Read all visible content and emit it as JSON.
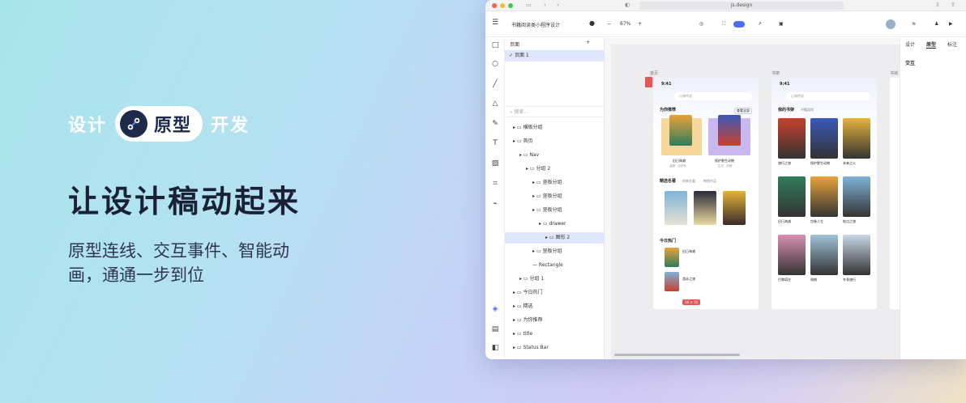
{
  "hero": {
    "tag_left": "设计",
    "pill_label": "原型",
    "tag_right": "开发",
    "headline": "让设计稿动起来",
    "subtitle": "原型连线、交互事件、智能动画，通通一步到位"
  },
  "browser": {
    "url": "js.design"
  },
  "toolbar": {
    "file_name": "书籍阅读类小程序设计",
    "zoom": "67%"
  },
  "layers": {
    "tab_label": "页面",
    "page": "页面 1",
    "search_placeholder": "搜索...",
    "items": [
      "横板分组",
      "首页",
      "Nav",
      "分组 2",
      "竖板分组",
      "竖板分组",
      "竖板分组",
      "drawer",
      "图形 2",
      "竖板分组",
      "Rectangle",
      "分组 1",
      "今日热门",
      "精选",
      "为你推荐",
      "title",
      "Status Bar"
    ]
  },
  "canvas": {
    "frame1_label": "首页",
    "frame2_label": "书架",
    "frame3_label": "书城",
    "size_tag": "16 × 16",
    "phone1": {
      "time": "9:41",
      "search": "山海传说",
      "sec1": "为你推荐",
      "more": "查看全部",
      "book1": "旧日海滩",
      "book1_sub": "温暖 · 治愈系",
      "book2": "保护野生动物",
      "book2_sub": "生态 · 科普",
      "sec2": "精选名著",
      "tab2": "经典名著",
      "tab3": "畅销作品",
      "sec3": "今日热门",
      "item1": "旧日海滩",
      "item2": "游泳之旅"
    },
    "phone2": {
      "time": "9:41",
      "search": "山海传说",
      "sec1": "我的书架",
      "tab": "书籍游戏",
      "titles": [
        "旅行之旅",
        "保护野生动物",
        "未来之火",
        "旧日海滩",
        "包装人生",
        "地点之旅",
        "巴黎塔往",
        "周期",
        "冬季旅行"
      ]
    }
  },
  "rpanel": {
    "tab1": "设计",
    "tab2": "原型",
    "tab3": "标注",
    "section": "交互"
  },
  "colors": {
    "accent": "#4b6ef5",
    "logo_bg": "#1e2a4a",
    "headline": "#1a2036"
  }
}
